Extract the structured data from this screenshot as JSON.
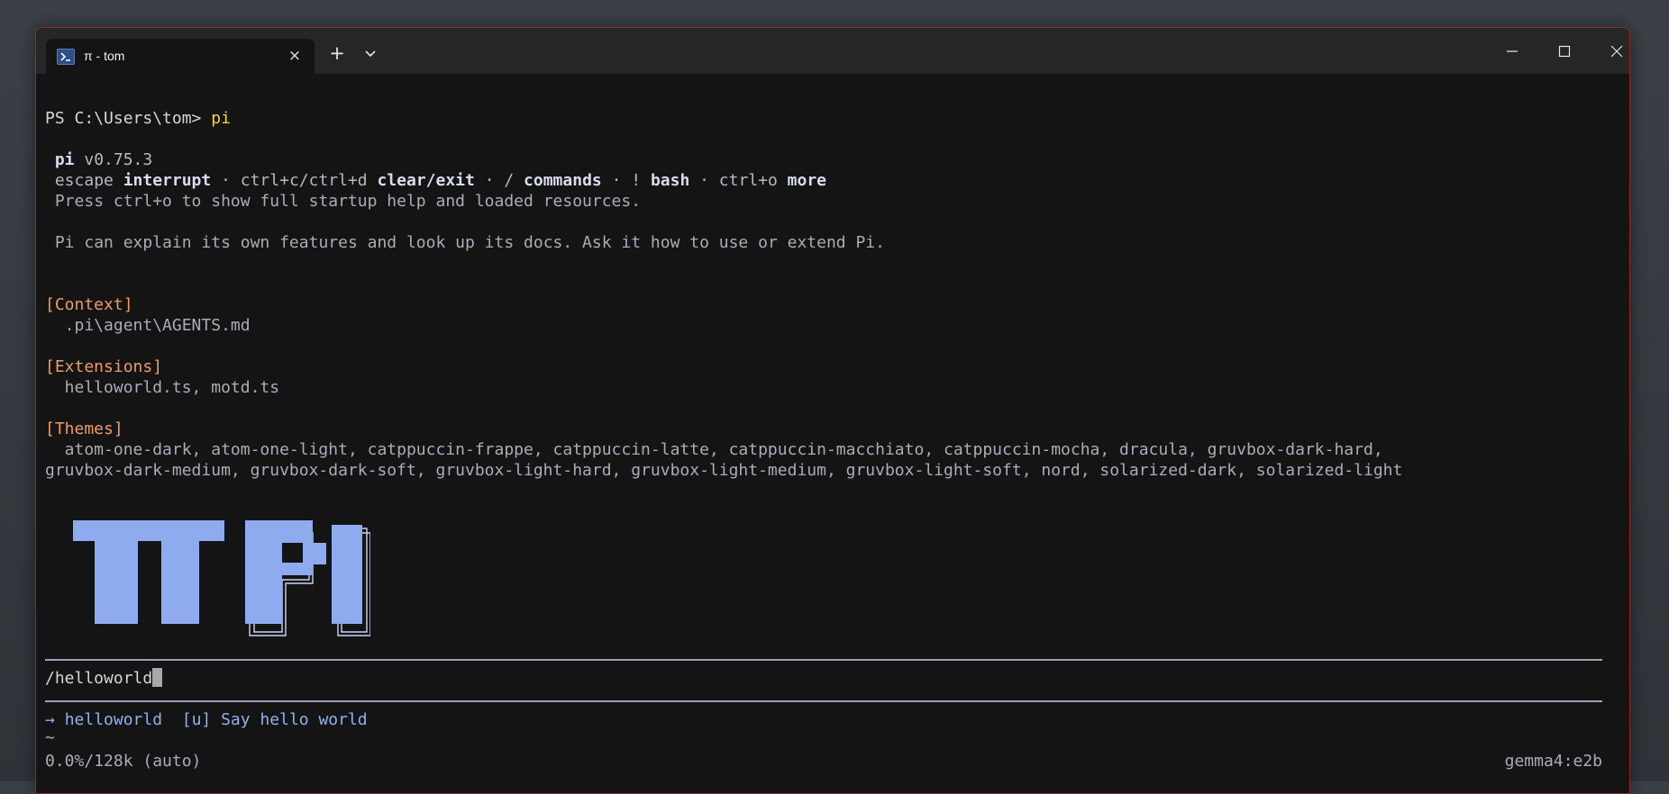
{
  "window": {
    "tab_title": "π - tom",
    "tab_icon": "powershell-icon",
    "controls": [
      "minimize-icon",
      "maximize-icon",
      "close-icon"
    ]
  },
  "terminal": {
    "prompt": "PS C:\\Users\\tom> ",
    "command": "pi",
    "app_name": "pi",
    "version": "v0.75.3",
    "keys": [
      {
        "key": "escape ",
        "action": "interrupt"
      },
      {
        "key": " · ctrl+c/ctrl+d ",
        "action": "clear/exit"
      },
      {
        "key": " · / ",
        "action": "commands"
      },
      {
        "key": " · ! ",
        "action": "bash"
      },
      {
        "key": " · ctrl+o ",
        "action": "more"
      }
    ],
    "help_hint": "Press ctrl+o to show full startup help and loaded resources.",
    "intro": "Pi can explain its own features and look up its docs. Ask it how to use or extend Pi.",
    "sections": {
      "context_header": "[Context]",
      "context_items": "  .pi\\agent\\AGENTS.md",
      "extensions_header": "[Extensions]",
      "extensions_items": "  helloworld.ts, motd.ts",
      "themes_header": "[Themes]",
      "themes_line1": "  atom-one-dark, atom-one-light, catppuccin-frappe, catppuccin-latte, catppuccin-macchiato, catppuccin-mocha, dracula, gruvbox-dark-hard,",
      "themes_line2": "gruvbox-dark-medium, gruvbox-dark-soft, gruvbox-light-hard, gruvbox-light-medium, gruvbox-light-soft, nord, solarized-dark, solarized-light"
    },
    "logo_text": "PI",
    "input_value": "/helloworld",
    "suggestion": {
      "arrow": "→ ",
      "name": "helloworld",
      "scope": "  [u] ",
      "description": "Say hello world"
    },
    "tilde": "~",
    "status_left": "0.0%/128k (auto)",
    "status_right": "gemma4:e2b",
    "colors": {
      "background": "#141414",
      "prompt_command": "#f5d63d",
      "section_header": "#ec9b67",
      "accent_blue": "#8fb2ee",
      "text": "#b5b9c4"
    }
  }
}
